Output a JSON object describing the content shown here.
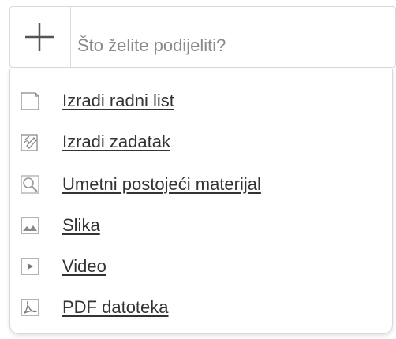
{
  "share": {
    "placeholder": "Što želite podijeliti?"
  },
  "menu": {
    "items": [
      {
        "label": "Izradi radni list",
        "icon": "worksheet-icon"
      },
      {
        "label": "Izradi zadatak",
        "icon": "task-icon"
      },
      {
        "label": "Umetni postojeći materijal",
        "icon": "search-material-icon"
      },
      {
        "label": "Slika",
        "icon": "image-icon"
      },
      {
        "label": "Video",
        "icon": "video-icon"
      },
      {
        "label": "PDF datoteka",
        "icon": "pdf-icon"
      }
    ]
  }
}
